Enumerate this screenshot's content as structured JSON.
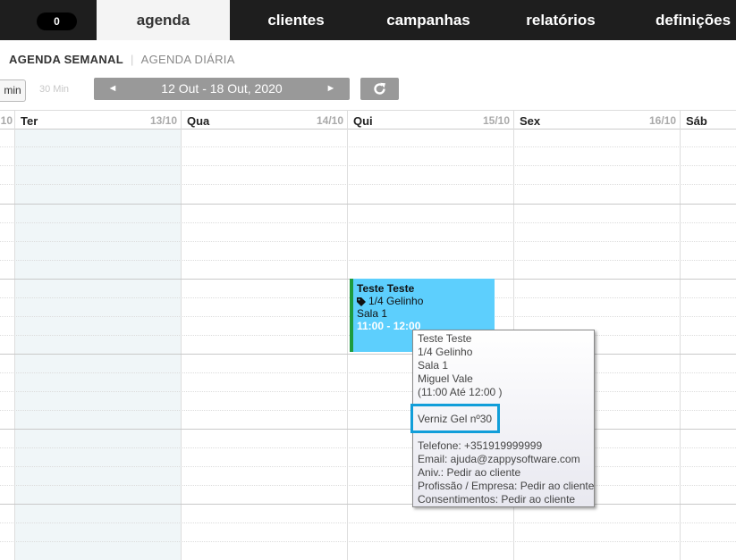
{
  "nav": {
    "badge": "0",
    "tabs": [
      "agenda",
      "clientes",
      "campanhas",
      "relatórios",
      "definições"
    ]
  },
  "subtabs": {
    "active": "AGENDA SEMANAL",
    "separator": "|",
    "other": "AGENDA DIÁRIA"
  },
  "toolbar": {
    "min_button": "min",
    "interval_label": "30 Min",
    "date_range": "12 Out - 18 Out, 2020",
    "prev_arrow": "◄",
    "next_arrow": "►",
    "refresh_icon": "refresh-icon"
  },
  "calendar": {
    "partial_prev_date": "10",
    "columns": [
      {
        "day": "Ter",
        "date": "13/10"
      },
      {
        "day": "Qua",
        "date": "14/10"
      },
      {
        "day": "Qui",
        "date": "15/10"
      },
      {
        "day": "Sex",
        "date": "16/10"
      },
      {
        "day": "Sáb",
        "date": ""
      }
    ]
  },
  "event": {
    "title": "Teste Teste",
    "service": "1/4 Gelinho",
    "room": "Sala 1",
    "time": "11:00 - 12:00",
    "color": "#5dcffd",
    "border_color": "#1e9b3f"
  },
  "tooltip": {
    "name": "Teste Teste",
    "service": "1/4 Gelinho",
    "room": "Sala 1",
    "staff": "Miguel Vale",
    "time": "(11:00 Até 12:00 )",
    "note": "Verniz Gel nº30",
    "phone": "Telefone: +351919999999",
    "email": "Email: ajuda@zappysoftware.com",
    "birthday": "Aniv.: Pedir ao cliente",
    "profession": "Profissão / Empresa: Pedir ao cliente",
    "consent": "Consentimentos: Pedir ao cliente",
    "highlight_color": "#119ed9"
  }
}
